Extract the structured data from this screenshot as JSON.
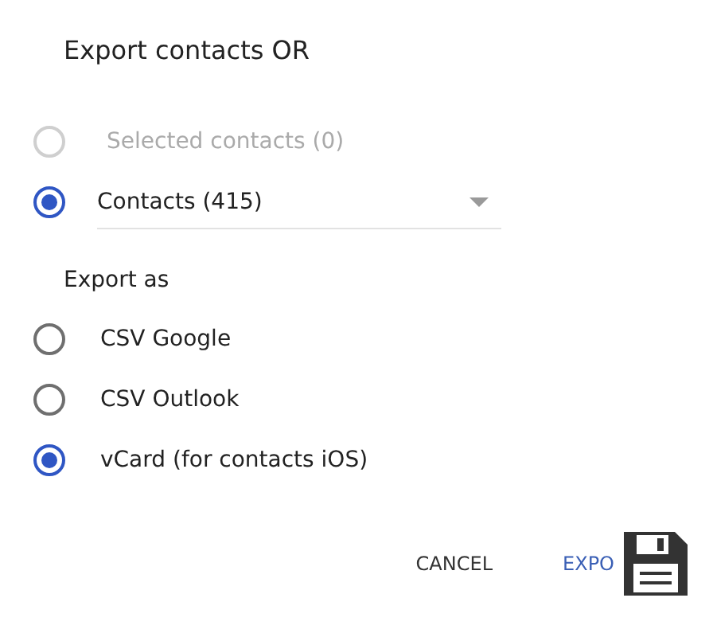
{
  "title": "Export contacts OR",
  "source_options": [
    {
      "label": "Selected contacts (0)",
      "selected": false,
      "disabled": true,
      "kind": "plain"
    },
    {
      "label": "Contacts (415)",
      "selected": true,
      "disabled": false,
      "kind": "dropdown"
    }
  ],
  "export_as": {
    "label": "Export as",
    "options": [
      {
        "label": "CSV Google",
        "selected": false
      },
      {
        "label": "CSV Outlook",
        "selected": false
      },
      {
        "label": "vCard (for contacts iOS)",
        "selected": true
      }
    ]
  },
  "buttons": [
    {
      "label": "CANCEL",
      "kind": "text"
    },
    {
      "label": "EXPO",
      "kind": "primary"
    }
  ]
}
